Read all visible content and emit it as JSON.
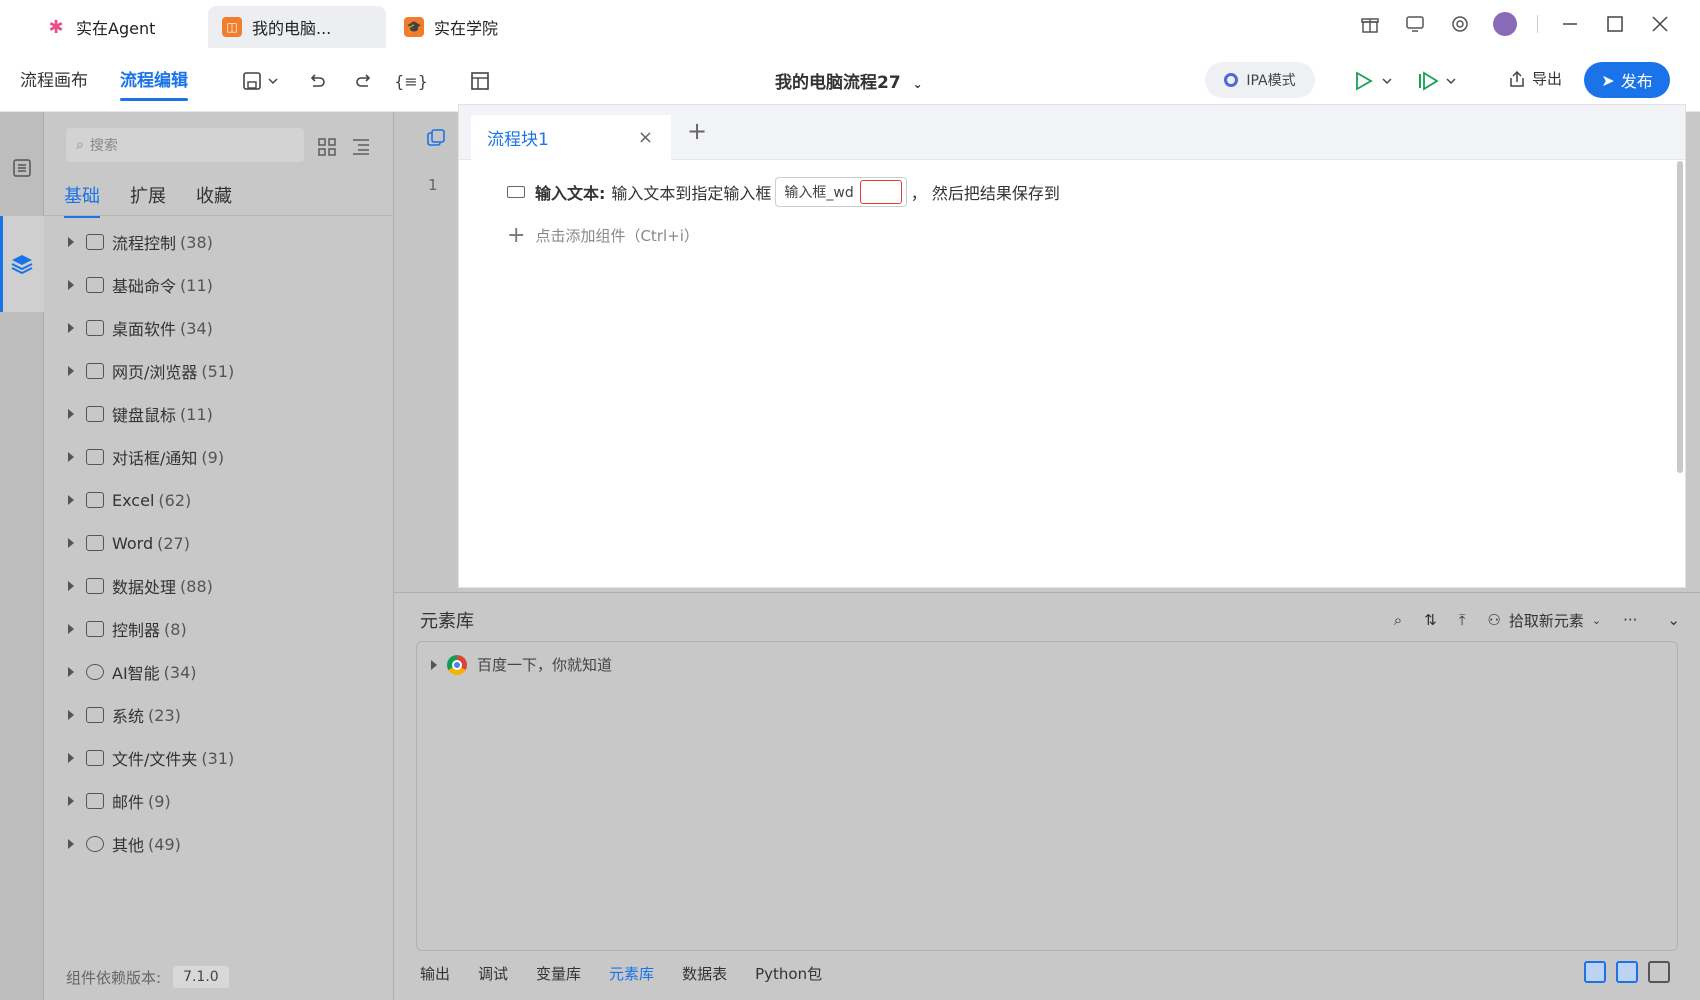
{
  "titlebar": {
    "tabs": [
      {
        "label": "实在Agent",
        "icon": "agent-star-icon"
      },
      {
        "label": "我的电脑...",
        "icon": "flow-app-icon"
      },
      {
        "label": "实在学院",
        "icon": "academy-icon"
      }
    ],
    "icons": [
      "gift-icon",
      "monitor-icon",
      "settings-icon",
      "avatar",
      "minimize-icon",
      "maximize-icon",
      "close-icon"
    ]
  },
  "toolbar": {
    "tabs": [
      "流程画布",
      "流程编辑"
    ],
    "active_tab": "流程编辑",
    "flow_title": "我的电脑流程27",
    "ipa_label": "IPA模式",
    "export_label": "导出",
    "publish_label": "发布"
  },
  "panel": {
    "search_placeholder": "搜索",
    "tabs": [
      "基础",
      "扩展",
      "收藏"
    ],
    "active_tab": "基础",
    "categories": [
      {
        "label": "流程控制",
        "count": "(38)"
      },
      {
        "label": "基础命令",
        "count": "(11)"
      },
      {
        "label": "桌面软件",
        "count": "(34)"
      },
      {
        "label": "网页/浏览器",
        "count": "(51)"
      },
      {
        "label": "键盘鼠标",
        "count": "(11)"
      },
      {
        "label": "对话框/通知",
        "count": "(9)"
      },
      {
        "label": "Excel",
        "count": "(62)"
      },
      {
        "label": "Word",
        "count": "(27)"
      },
      {
        "label": "数据处理",
        "count": "(88)"
      },
      {
        "label": "控制器",
        "count": "(8)"
      },
      {
        "label": "AI智能",
        "count": "(34)"
      },
      {
        "label": "系统",
        "count": "(23)"
      },
      {
        "label": "文件/文件夹",
        "count": "(31)"
      },
      {
        "label": "邮件",
        "count": "(9)"
      },
      {
        "label": "其他",
        "count": "(49)"
      }
    ],
    "version_label": "组件依赖版本:",
    "version_value": "7.1.0"
  },
  "editor": {
    "tab_label": "流程块1",
    "line_number": "1",
    "statement": {
      "title": "输入文本:",
      "desc": "输入文本到指定输入框",
      "field": "输入框_wd",
      "suffix": "， 然后把结果保存到"
    },
    "add_component": "点击添加组件（Ctrl+i）"
  },
  "library": {
    "title": "元素库",
    "pick_label": "拾取新元素",
    "item": "百度一下，你就知道",
    "bottom_tabs": [
      "输出",
      "调试",
      "变量库",
      "元素库",
      "数据表",
      "Python包"
    ],
    "active_bottom_tab": "元素库"
  },
  "colors": {
    "accent": "#1a73e8",
    "play_green": "#18a058"
  }
}
